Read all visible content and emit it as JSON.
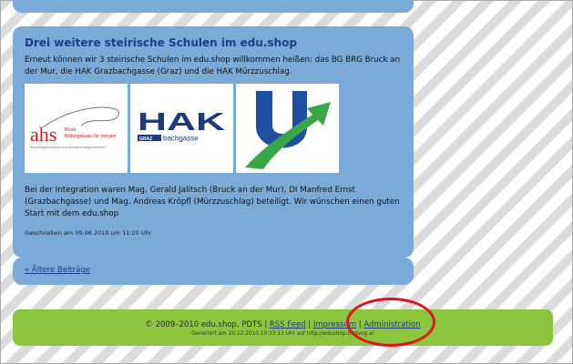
{
  "post": {
    "title": "Drei weitere steirische Schulen im edu.shop",
    "intro": "Erneut können wir 3 steirische Schulen im edu.shop willkommen heißen: das BG BRG Bruck an der Mur, die HAK Grazbachgasse (Graz) und die HAK Mürzzuschlag.",
    "logos": {
      "ahs": {
        "main": "ahs",
        "small1": "Bruck",
        "small2": "Bildungsbasis für morgen",
        "small3": "Bundesgymnasium und Bundesrealgymnasium"
      },
      "hak": {
        "main": "HAK",
        "sub1": "GRAZ",
        "sub2": "bachgasse"
      }
    },
    "body": "Bei der Integration waren Mag. Gerald Jalitsch (Bruck an der Mur), DI Manfred Ernst (Grazbachgasse) und Mag. Andreas Kröpfl (Mürzzuschlag) beteiligt. Wir wünschen einen guten Start mit dem edu.shop",
    "date": "Geschrieben am 09.06.2010 um 11:20 Uhr"
  },
  "older_link": "« Ältere Beiträge",
  "footer": {
    "copyright": "© 2009–2010 edu.shop, PDTS | ",
    "rss": "RSS Feed",
    "sep1": " | ",
    "impressum": "Impressum",
    "sep2": " | ",
    "administration": "Administration",
    "generated": "Generiert am 20.12.2010 10:33:13 Uhr auf http://edushop.bildung.at"
  },
  "colors": {
    "card_blue": "#7aaad8",
    "title_blue": "#1a3f86",
    "footer_green": "#8cc63f",
    "highlight_red": "#e0141b"
  }
}
